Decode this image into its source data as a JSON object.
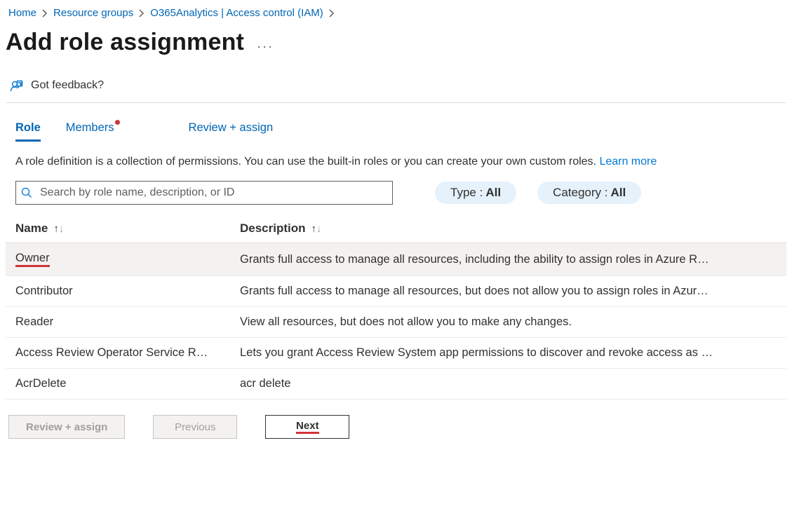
{
  "breadcrumb": {
    "items": [
      "Home",
      "Resource groups",
      "O365Analytics | Access control (IAM)"
    ]
  },
  "page": {
    "title": "Add role assignment",
    "feedback_label": "Got feedback?"
  },
  "tabs": {
    "role": "Role",
    "members": "Members",
    "review": "Review + assign"
  },
  "description": {
    "text": "A role definition is a collection of permissions. You can use the built-in roles or you can create your own custom roles. ",
    "learn_more": "Learn more"
  },
  "search": {
    "placeholder": "Search by role name, description, or ID"
  },
  "filters": {
    "type_label": "Type : ",
    "type_value": "All",
    "category_label": "Category : ",
    "category_value": "All"
  },
  "table": {
    "headers": {
      "name": "Name",
      "description": "Description"
    },
    "rows": [
      {
        "name": "Owner",
        "description": "Grants full access to manage all resources, including the ability to assign roles in Azure R…",
        "selected": true,
        "mark": true
      },
      {
        "name": "Contributor",
        "description": "Grants full access to manage all resources, but does not allow you to assign roles in Azur…"
      },
      {
        "name": "Reader",
        "description": "View all resources, but does not allow you to make any changes."
      },
      {
        "name": "Access Review Operator Service R…",
        "description": "Lets you grant Access Review System app permissions to discover and revoke access as …"
      },
      {
        "name": "AcrDelete",
        "description": "acr delete"
      }
    ]
  },
  "footer": {
    "review": "Review + assign",
    "previous": "Previous",
    "next": "Next"
  }
}
